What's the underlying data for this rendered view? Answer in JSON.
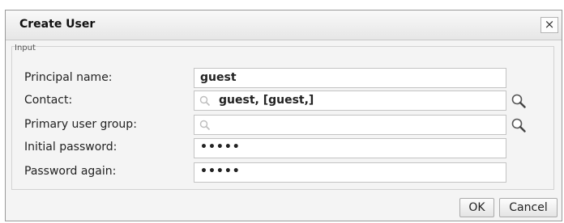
{
  "dialog": {
    "title": "Create User",
    "close_label": "×"
  },
  "form": {
    "legend": "Input",
    "fields": [
      {
        "label": "Principal name:",
        "value": "guest"
      },
      {
        "label": "Contact:",
        "value": "guest, [guest,]"
      },
      {
        "label": "Primary user group:",
        "value": ""
      },
      {
        "label": "Initial password:",
        "value": "•••••"
      },
      {
        "label": "Password again:",
        "value": "•••••"
      }
    ]
  },
  "buttons": {
    "ok_label": "OK",
    "cancel_label": "Cancel"
  }
}
